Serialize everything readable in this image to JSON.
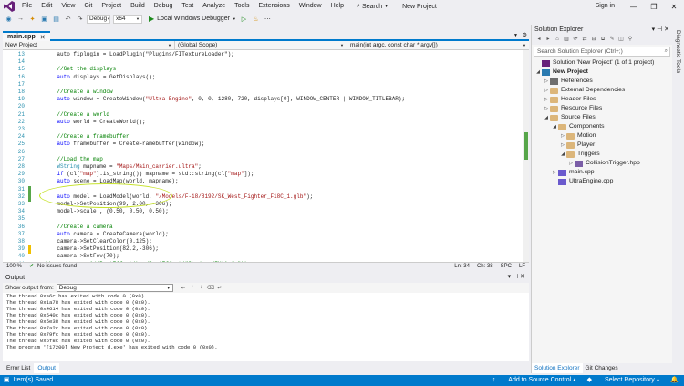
{
  "menubar": {
    "items": [
      "File",
      "Edit",
      "View",
      "Git",
      "Project",
      "Build",
      "Debug",
      "Test",
      "Analyze",
      "Tools",
      "Extensions",
      "Window",
      "Help"
    ],
    "search_label": "Search",
    "project_title": "New Project",
    "sign_in": "Sign in",
    "window_controls": [
      "—",
      "❐",
      "✕"
    ]
  },
  "toolbar": {
    "config": "Debug",
    "platform": "x64",
    "run_label": "Local Windows Debugger"
  },
  "editor": {
    "tab_name": "main.cpp",
    "tab_close": "✕",
    "nav": {
      "project": "New Project",
      "scope": "(Global Scope)",
      "function": "main(int argc, const char * argv[])"
    },
    "lines": [
      {
        "n": "13",
        "segs": [
          [
            "",
            "    auto fiplugin = LoadPlugin(\"Plugins/FITextureLoader\");"
          ]
        ]
      },
      {
        "n": "14",
        "segs": [
          [
            "",
            ""
          ]
        ]
      },
      {
        "n": "15",
        "segs": [
          [
            "cm",
            "    //Get the displays"
          ]
        ]
      },
      {
        "n": "16",
        "segs": [
          [
            "kw",
            "    auto"
          ],
          [
            "",
            " displays = GetDisplays();"
          ]
        ]
      },
      {
        "n": "17",
        "segs": [
          [
            "",
            ""
          ]
        ]
      },
      {
        "n": "18",
        "segs": [
          [
            "cm",
            "    //Create a window"
          ]
        ]
      },
      {
        "n": "19",
        "segs": [
          [
            "kw",
            "    auto"
          ],
          [
            "",
            " window = CreateWindow("
          ],
          [
            "str",
            "\"Ultra Engine\""
          ],
          [
            "",
            ", 0, 0, 1280, 720, displays[0], WINDOW_CENTER | WINDOW_TITLEBAR);"
          ]
        ]
      },
      {
        "n": "20",
        "segs": [
          [
            "",
            ""
          ]
        ]
      },
      {
        "n": "21",
        "segs": [
          [
            "cm",
            "    //Create a world"
          ]
        ]
      },
      {
        "n": "22",
        "segs": [
          [
            "kw",
            "    auto"
          ],
          [
            "",
            " world = CreateWorld();"
          ]
        ]
      },
      {
        "n": "23",
        "segs": [
          [
            "",
            ""
          ]
        ]
      },
      {
        "n": "24",
        "segs": [
          [
            "cm",
            "    //Create a framebuffer"
          ]
        ]
      },
      {
        "n": "25",
        "segs": [
          [
            "kw",
            "    auto"
          ],
          [
            "",
            " framebuffer = CreateFramebuffer(window);"
          ]
        ]
      },
      {
        "n": "26",
        "segs": [
          [
            "",
            ""
          ]
        ]
      },
      {
        "n": "27",
        "segs": [
          [
            "cm",
            "    //Load the map"
          ]
        ]
      },
      {
        "n": "28",
        "segs": [
          [
            "ty",
            "    WString"
          ],
          [
            "",
            " mapname = "
          ],
          [
            "str",
            "\"Maps/Main_carrier.ultra\""
          ],
          [
            "",
            ";"
          ]
        ]
      },
      {
        "n": "29",
        "segs": [
          [
            "kw",
            "    if"
          ],
          [
            "",
            " (cl["
          ],
          [
            "str",
            "\"map\""
          ],
          [
            "",
            "].is_string()) mapname = std::string(cl["
          ],
          [
            "str",
            "\"map\""
          ],
          [
            "",
            "]);"
          ]
        ]
      },
      {
        "n": "30",
        "segs": [
          [
            "kw",
            "    auto"
          ],
          [
            "",
            " scene = LoadMap(world, mapname);"
          ]
        ]
      },
      {
        "n": "31",
        "segs": [
          [
            "",
            ""
          ]
        ]
      },
      {
        "n": "32",
        "segs": [
          [
            "kw",
            "    auto"
          ],
          [
            "",
            " model = LoadModel(world, "
          ],
          [
            "str",
            "\"/Models/F-18/8192/SK_West_Fighter_F18C_1.glb\""
          ],
          [
            "",
            ");"
          ]
        ]
      },
      {
        "n": "33",
        "segs": [
          [
            "",
            "    model->SetPosition(99, 2.00, -306);"
          ]
        ]
      },
      {
        "n": "34",
        "segs": [
          [
            "",
            "    model->scale , (0.50, 0.50, 0.50);"
          ]
        ]
      },
      {
        "n": "35",
        "segs": [
          [
            "",
            ""
          ]
        ]
      },
      {
        "n": "36",
        "segs": [
          [
            "cm",
            "    //Create a camera"
          ]
        ]
      },
      {
        "n": "37",
        "segs": [
          [
            "kw",
            "    auto"
          ],
          [
            "",
            " camera = CreateCamera(world);"
          ]
        ]
      },
      {
        "n": "38",
        "segs": [
          [
            "",
            "    camera->SetClearColor(0.125);"
          ]
        ]
      },
      {
        "n": "39",
        "segs": [
          [
            "",
            "    camera->SetPosition(82,2,-306);"
          ]
        ]
      },
      {
        "n": "40",
        "segs": [
          [
            "",
            "    camera->SetFov(70);"
          ]
        ]
      },
      {
        "n": "41",
        "segs": [
          [
            "cm",
            "//    camera->AddPostEffect(LoadPostEffect(\"Shaders/FXAA.fx\"));"
          ]
        ]
      },
      {
        "n": "42",
        "segs": [
          [
            "",
            ""
          ]
        ]
      },
      {
        "n": "43",
        "segs": [
          [
            "cm",
            "    ////Add camera controls"
          ]
        ]
      }
    ],
    "status": {
      "zoom": "100 %",
      "issues": "No issues found",
      "ln": "Ln: 34",
      "ch": "Ch: 38",
      "spc": "SPC",
      "lf": "LF"
    }
  },
  "output": {
    "title": "Output",
    "show_from_label": "Show output from:",
    "source": "Debug",
    "lines": [
      "The thread 0xa6c has exited with code 0 (0x0).",
      "The thread 0x1a78 has exited with code 0 (0x0).",
      "The thread 0x4614 has exited with code 0 (0x0).",
      "The thread 0x540c has exited with code 0 (0x0).",
      "The thread 0x5e38 has exited with code 0 (0x0).",
      "The thread 0x7a2c has exited with code 0 (0x0).",
      "The thread 0x79fc has exited with code 0 (0x0).",
      "The thread 0x6f8c has exited with code 0 (0x0).",
      "The program '[17200] New Project_d.exe' has exited with code 0 (0x0)."
    ],
    "tabs": [
      "Error List",
      "Output"
    ]
  },
  "solution_explorer": {
    "title": "Solution Explorer",
    "search_placeholder": "Search Solution Explorer (Ctrl+;)",
    "tree": [
      {
        "label": "Solution 'New Project' (1 of 1 project)",
        "indent": 0,
        "icon": "sol-ico",
        "arrow": ""
      },
      {
        "label": "New Project",
        "indent": 0,
        "icon": "proj-ico",
        "arrow": "◢",
        "bold": true
      },
      {
        "label": "References",
        "indent": 1,
        "icon": "ref-ico",
        "arrow": "▷"
      },
      {
        "label": "External Dependencies",
        "indent": 1,
        "icon": "folder",
        "arrow": "▷"
      },
      {
        "label": "Header Files",
        "indent": 1,
        "icon": "folder",
        "arrow": "▷"
      },
      {
        "label": "Resource Files",
        "indent": 1,
        "icon": "folder",
        "arrow": "▷"
      },
      {
        "label": "Source Files",
        "indent": 1,
        "icon": "folder",
        "arrow": "◢"
      },
      {
        "label": "Components",
        "indent": 2,
        "icon": "folder",
        "arrow": "◢"
      },
      {
        "label": "Motion",
        "indent": 3,
        "icon": "folder",
        "arrow": "▷"
      },
      {
        "label": "Player",
        "indent": 3,
        "icon": "folder",
        "arrow": "▷"
      },
      {
        "label": "Triggers",
        "indent": 3,
        "icon": "folder",
        "arrow": "◢"
      },
      {
        "label": "CollisionTrigger.hpp",
        "indent": 4,
        "icon": "file-hpp",
        "arrow": "▷"
      },
      {
        "label": "main.cpp",
        "indent": 2,
        "icon": "file-cpp",
        "arrow": "▷"
      },
      {
        "label": "UltraEngine.cpp",
        "indent": 2,
        "icon": "file-cpp",
        "arrow": ""
      }
    ],
    "tabs": [
      "Solution Explorer",
      "Git Changes"
    ]
  },
  "diagnostic_label": "Diagnostic Tools",
  "statusbar": {
    "left": "Item(s) Saved",
    "add_source": "Add to Source Control",
    "select_repo": "Select Repository"
  },
  "colors": {
    "accent": "#007acc",
    "green_bar": "#57a64a",
    "highlight": "#c6e22a"
  }
}
